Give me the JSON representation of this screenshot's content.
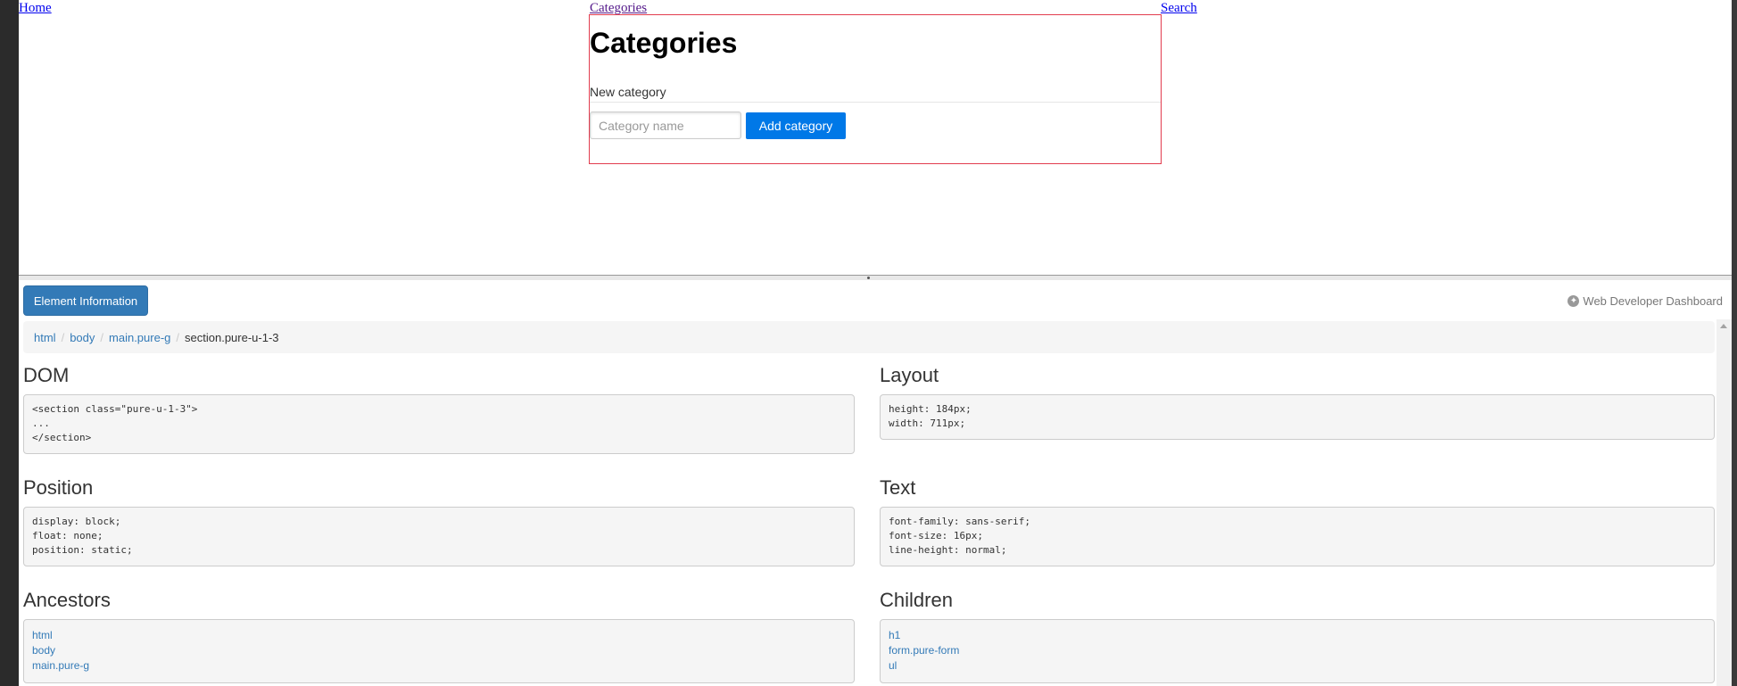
{
  "nav": {
    "home": "Home",
    "categories": "Categories",
    "search": "Search"
  },
  "section": {
    "title": "Categories",
    "form_legend": "New category",
    "input_placeholder": "Category name",
    "add_button": "Add category"
  },
  "dashboard": {
    "element_info_button": "Element Information",
    "title": "Web Developer Dashboard",
    "breadcrumb": [
      "html",
      "body",
      "main.pure-g",
      "section.pure-u-1-3"
    ],
    "panels": {
      "dom": {
        "title": "DOM",
        "lines": [
          "<section class=\"pure-u-1-3\">",
          "...",
          "</section>"
        ]
      },
      "layout": {
        "title": "Layout",
        "lines": [
          "height: 184px;",
          "width: 711px;"
        ]
      },
      "position": {
        "title": "Position",
        "lines": [
          "display: block;",
          "float: none;",
          "position: static;"
        ]
      },
      "text": {
        "title": "Text",
        "lines": [
          "font-family: sans-serif;",
          "font-size: 16px;",
          "line-height: normal;"
        ]
      },
      "ancestors": {
        "title": "Ancestors",
        "links": [
          "html",
          "body",
          "main.pure-g"
        ]
      },
      "children": {
        "title": "Children",
        "links": [
          "h1",
          "form.pure-form",
          "ul"
        ]
      }
    }
  },
  "colors": {
    "highlight_border": "#e23c4e",
    "primary_button": "#0078e7",
    "dashboard_button": "#337ab7",
    "link": "#337ab7"
  },
  "icons": {
    "dashboard_title": "globe-icon",
    "splitter": "grip-dot-icon",
    "scroll_up": "scroll-up-arrow-icon"
  }
}
